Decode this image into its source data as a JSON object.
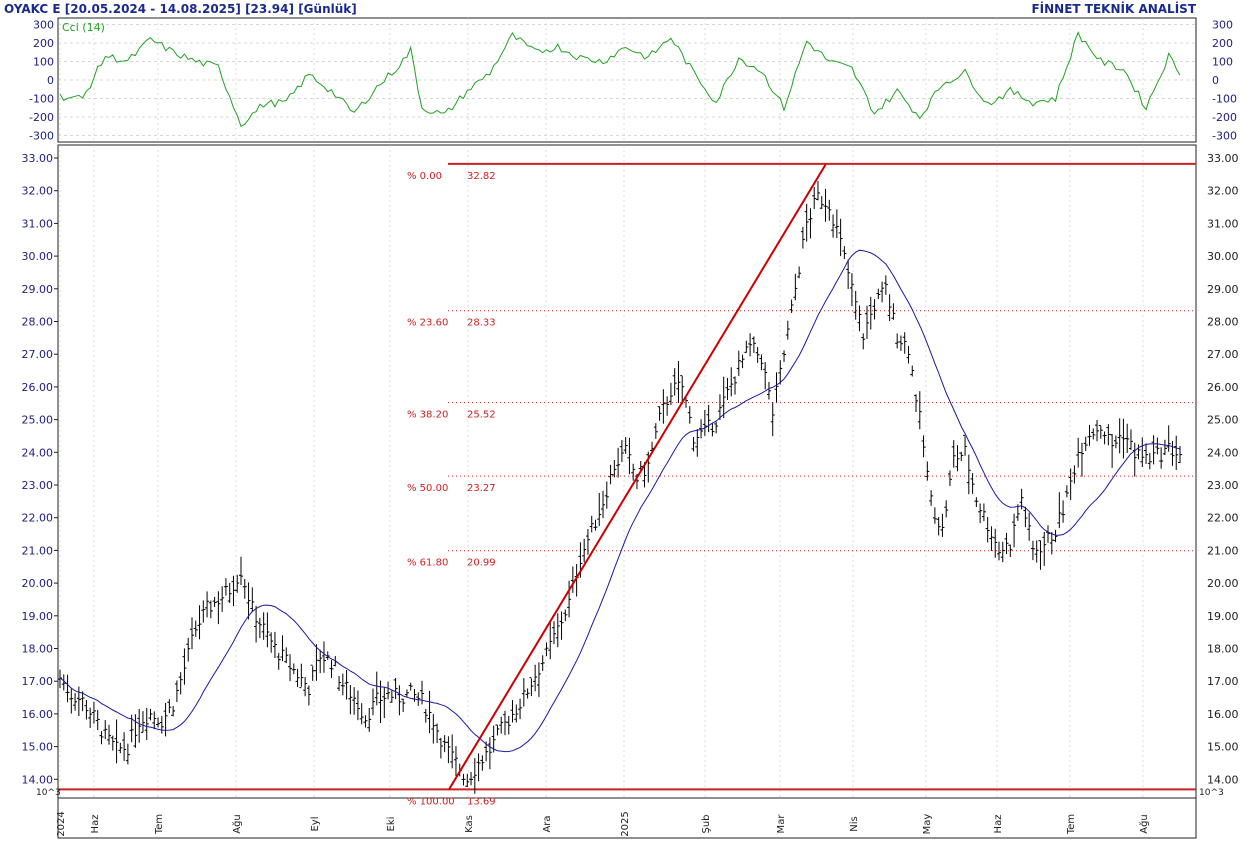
{
  "header": {
    "ticker": "OYAKC E",
    "range": "[20.05.2024 - 14.08.2025]",
    "last": "[23.94]",
    "period": "[Günlük]",
    "brand": "FİNNET TEKNİK ANALİST"
  },
  "colors": {
    "price_bars": "#000000",
    "moving_average": "#1a1aa0",
    "cci": "#22a022",
    "fib_lines": "#cc2222",
    "trend_line": "#cc0000",
    "axis_text_left": "#202080"
  },
  "cci_panel": {
    "label": "Cci (14)",
    "yticks": [
      "300",
      "200",
      "100",
      "0",
      "-100",
      "-200",
      "-300"
    ]
  },
  "price_panel": {
    "yticks": [
      "33.00",
      "32.00",
      "31.00",
      "30.00",
      "29.00",
      "28.00",
      "27.00",
      "26.00",
      "25.00",
      "24.00",
      "23.00",
      "22.00",
      "21.00",
      "20.00",
      "19.00",
      "18.00",
      "17.00",
      "16.00",
      "15.00",
      "14.00"
    ],
    "scale_note": "10^3"
  },
  "xaxis": {
    "labels": [
      "2024",
      "Haz",
      "Tem",
      "Ağu",
      "Eyl",
      "Eki",
      "Kas",
      "Ara",
      "2025",
      "Şub",
      "Mar",
      "Nis",
      "May",
      "Haz",
      "Tem",
      "Ağu"
    ]
  },
  "fibonacci": [
    {
      "pct": "% 0.00",
      "value": "32.82"
    },
    {
      "pct": "% 23.60",
      "value": "28.33"
    },
    {
      "pct": "% 38.20",
      "value": "25.52"
    },
    {
      "pct": "% 50.00",
      "value": "23.27"
    },
    {
      "pct": "% 61.80",
      "value": "20.99"
    },
    {
      "pct": "% 100.00",
      "value": "13.69"
    }
  ],
  "chart_data": {
    "type": "line",
    "x_start": "20.05.2024",
    "x_end": "14.08.2025",
    "xlabels": [
      "2024",
      "Haz",
      "Tem",
      "Ağu",
      "Eyl",
      "Eki",
      "Kas",
      "Ara",
      "2025",
      "Şub",
      "Mar",
      "Nis",
      "May",
      "Haz",
      "Tem",
      "Ağu"
    ],
    "price_ylim": [
      13.69,
      33.0
    ],
    "cci_ylim": [
      -300,
      300
    ],
    "grid": true,
    "series": [
      {
        "name": "OYAKC E",
        "points": [
          [
            0,
            17.1
          ],
          [
            3,
            16.6
          ],
          [
            6,
            16.4
          ],
          [
            9,
            15.9
          ],
          [
            12,
            15.3
          ],
          [
            15,
            14.9
          ],
          [
            18,
            15.0
          ],
          [
            21,
            15.8
          ],
          [
            24,
            16.0
          ],
          [
            27,
            15.8
          ],
          [
            30,
            16.3
          ],
          [
            33,
            17.4
          ],
          [
            36,
            18.6
          ],
          [
            39,
            19.2
          ],
          [
            42,
            19.5
          ],
          [
            45,
            19.8
          ],
          [
            48,
            20.4
          ],
          [
            51,
            19.2
          ],
          [
            54,
            18.6
          ],
          [
            57,
            18.0
          ],
          [
            60,
            17.6
          ],
          [
            63,
            17.2
          ],
          [
            66,
            16.8
          ],
          [
            69,
            17.8
          ],
          [
            72,
            17.6
          ],
          [
            75,
            16.9
          ],
          [
            78,
            16.5
          ],
          [
            81,
            15.9
          ],
          [
            84,
            16.4
          ],
          [
            87,
            16.6
          ],
          [
            90,
            16.5
          ],
          [
            93,
            16.6
          ],
          [
            96,
            16.4
          ],
          [
            99,
            15.8
          ],
          [
            102,
            15.0
          ],
          [
            105,
            14.5
          ],
          [
            108,
            14.0
          ],
          [
            111,
            14.5
          ],
          [
            114,
            14.9
          ],
          [
            117,
            15.5
          ],
          [
            120,
            16.0
          ],
          [
            123,
            16.5
          ],
          [
            126,
            17.2
          ],
          [
            129,
            17.8
          ],
          [
            132,
            18.6
          ],
          [
            135,
            19.4
          ],
          [
            138,
            20.8
          ],
          [
            141,
            21.6
          ],
          [
            144,
            22.5
          ],
          [
            147,
            23.6
          ],
          [
            150,
            24.0
          ],
          [
            153,
            23.2
          ],
          [
            156,
            23.6
          ],
          [
            159,
            25.0
          ],
          [
            162,
            25.9
          ],
          [
            165,
            26.0
          ],
          [
            168,
            24.5
          ],
          [
            171,
            24.6
          ],
          [
            174,
            25.0
          ],
          [
            177,
            25.8
          ],
          [
            180,
            26.6
          ],
          [
            183,
            27.2
          ],
          [
            186,
            26.9
          ],
          [
            189,
            25.2
          ],
          [
            192,
            27.0
          ],
          [
            195,
            29.0
          ],
          [
            198,
            31.0
          ],
          [
            201,
            31.8
          ],
          [
            204,
            31.6
          ],
          [
            207,
            30.4
          ],
          [
            210,
            29.0
          ],
          [
            213,
            27.6
          ],
          [
            216,
            28.5
          ],
          [
            219,
            29.0
          ],
          [
            222,
            27.6
          ],
          [
            225,
            27.2
          ],
          [
            228,
            25.0
          ],
          [
            231,
            22.5
          ],
          [
            234,
            21.6
          ],
          [
            237,
            23.8
          ],
          [
            240,
            24.0
          ],
          [
            243,
            22.6
          ],
          [
            246,
            21.8
          ],
          [
            249,
            21.0
          ],
          [
            252,
            21.2
          ],
          [
            255,
            22.6
          ],
          [
            258,
            21.0
          ],
          [
            261,
            21.2
          ],
          [
            264,
            21.6
          ],
          [
            267,
            22.6
          ],
          [
            270,
            24.0
          ],
          [
            273,
            24.6
          ],
          [
            276,
            24.8
          ],
          [
            279,
            24.2
          ],
          [
            282,
            24.6
          ],
          [
            285,
            24.0
          ],
          [
            288,
            23.8
          ],
          [
            291,
            23.9
          ],
          [
            294,
            24.1
          ],
          [
            297,
            23.94
          ]
        ]
      },
      {
        "name": "MA",
        "points": []
      },
      {
        "name": "CCI (14)",
        "points": [
          [
            0,
            -90
          ],
          [
            6,
            -100
          ],
          [
            12,
            130
          ],
          [
            18,
            100
          ],
          [
            24,
            220
          ],
          [
            30,
            150
          ],
          [
            36,
            100
          ],
          [
            42,
            70
          ],
          [
            48,
            -240
          ],
          [
            54,
            -130
          ],
          [
            60,
            -120
          ],
          [
            66,
            30
          ],
          [
            72,
            -60
          ],
          [
            78,
            -180
          ],
          [
            84,
            -40
          ],
          [
            90,
            80
          ],
          [
            93,
            160
          ],
          [
            96,
            -150
          ],
          [
            102,
            -190
          ],
          [
            108,
            -60
          ],
          [
            114,
            40
          ],
          [
            120,
            240
          ],
          [
            126,
            150
          ],
          [
            132,
            180
          ],
          [
            138,
            120
          ],
          [
            144,
            100
          ],
          [
            150,
            180
          ],
          [
            156,
            120
          ],
          [
            162,
            230
          ],
          [
            168,
            40
          ],
          [
            174,
            -120
          ],
          [
            180,
            120
          ],
          [
            186,
            50
          ],
          [
            192,
            -150
          ],
          [
            198,
            210
          ],
          [
            204,
            100
          ],
          [
            210,
            60
          ],
          [
            216,
            -180
          ],
          [
            222,
            -60
          ],
          [
            228,
            -200
          ],
          [
            234,
            -20
          ],
          [
            240,
            40
          ],
          [
            246,
            -130
          ],
          [
            252,
            -60
          ],
          [
            258,
            -120
          ],
          [
            264,
            -100
          ],
          [
            270,
            250
          ],
          [
            276,
            100
          ],
          [
            282,
            60
          ],
          [
            288,
            -150
          ],
          [
            294,
            130
          ],
          [
            297,
            40
          ]
        ]
      }
    ]
  }
}
